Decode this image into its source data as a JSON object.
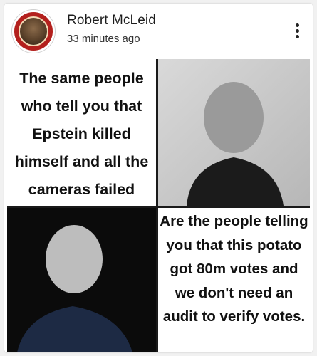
{
  "post": {
    "author": "Robert McLeid",
    "timestamp": "33 minutes ago"
  },
  "meme": {
    "top_left_text": "The same people who tell you that Epstein killed himself and all the cameras failed",
    "bottom_right_text": "Are the people telling you that this potato got 80m votes and we don't need an audit to verify votes."
  },
  "icons": {
    "more": "more-vert-icon"
  },
  "colors": {
    "card_bg": "#ffffff",
    "page_bg": "#f1f1f1",
    "text": "#1d1d1d",
    "avatar_ring": "#b3201d"
  }
}
